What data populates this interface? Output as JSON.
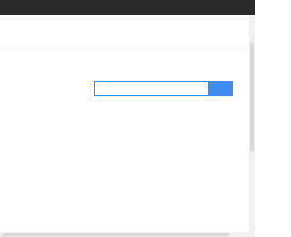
{
  "header": {
    "nav": [
      {
        "label": "",
        "hot": false
      },
      {
        "label": "",
        "hot": false
      },
      {
        "label": "",
        "hot": false
      },
      {
        "label": "",
        "hot": false
      },
      {
        "label": "",
        "hot": false
      },
      {
        "label": "",
        "hot": false
      },
      {
        "label": "",
        "hot": true
      },
      {
        "label": "",
        "hot": false
      },
      {
        "label": "",
        "hot": false
      },
      {
        "label": "",
        "hot": false
      },
      {
        "label": "",
        "hot": false
      }
    ]
  },
  "ticker": {
    "columns": [
      {
        "lines": [
          {
            "text": "",
            "tone": "dark"
          },
          {
            "text": "",
            "tone": "dark"
          },
          {
            "text": "",
            "tone": "red"
          }
        ]
      },
      {
        "lines": [
          {
            "text": "",
            "tone": "dark"
          },
          {
            "text": "",
            "tone": "dark"
          },
          {
            "text": "",
            "tone": "dark"
          }
        ]
      },
      {
        "lines": [
          {
            "text": "",
            "tone": "red"
          },
          {
            "text": "",
            "tone": "dark"
          },
          {
            "text": "",
            "tone": "red"
          }
        ]
      },
      {
        "lines": [
          {
            "text": "",
            "tone": "dark"
          },
          {
            "text": "",
            "tone": "dark"
          },
          {
            "text": "",
            "tone": "dark"
          }
        ]
      },
      {
        "lines": [
          {
            "text": "",
            "tone": "red"
          },
          {
            "text": "",
            "tone": "red"
          },
          {
            "text": "",
            "tone": "dark"
          }
        ]
      }
    ]
  },
  "search": {
    "brand_label": "",
    "placeholder": "",
    "value": "",
    "scope_label": "",
    "button_label": "",
    "hint_text": ""
  },
  "colors": {
    "topbar_bg": "#2b2b2b",
    "accent_blue": "#3d8ef0",
    "link_red": "#e03c3c"
  }
}
